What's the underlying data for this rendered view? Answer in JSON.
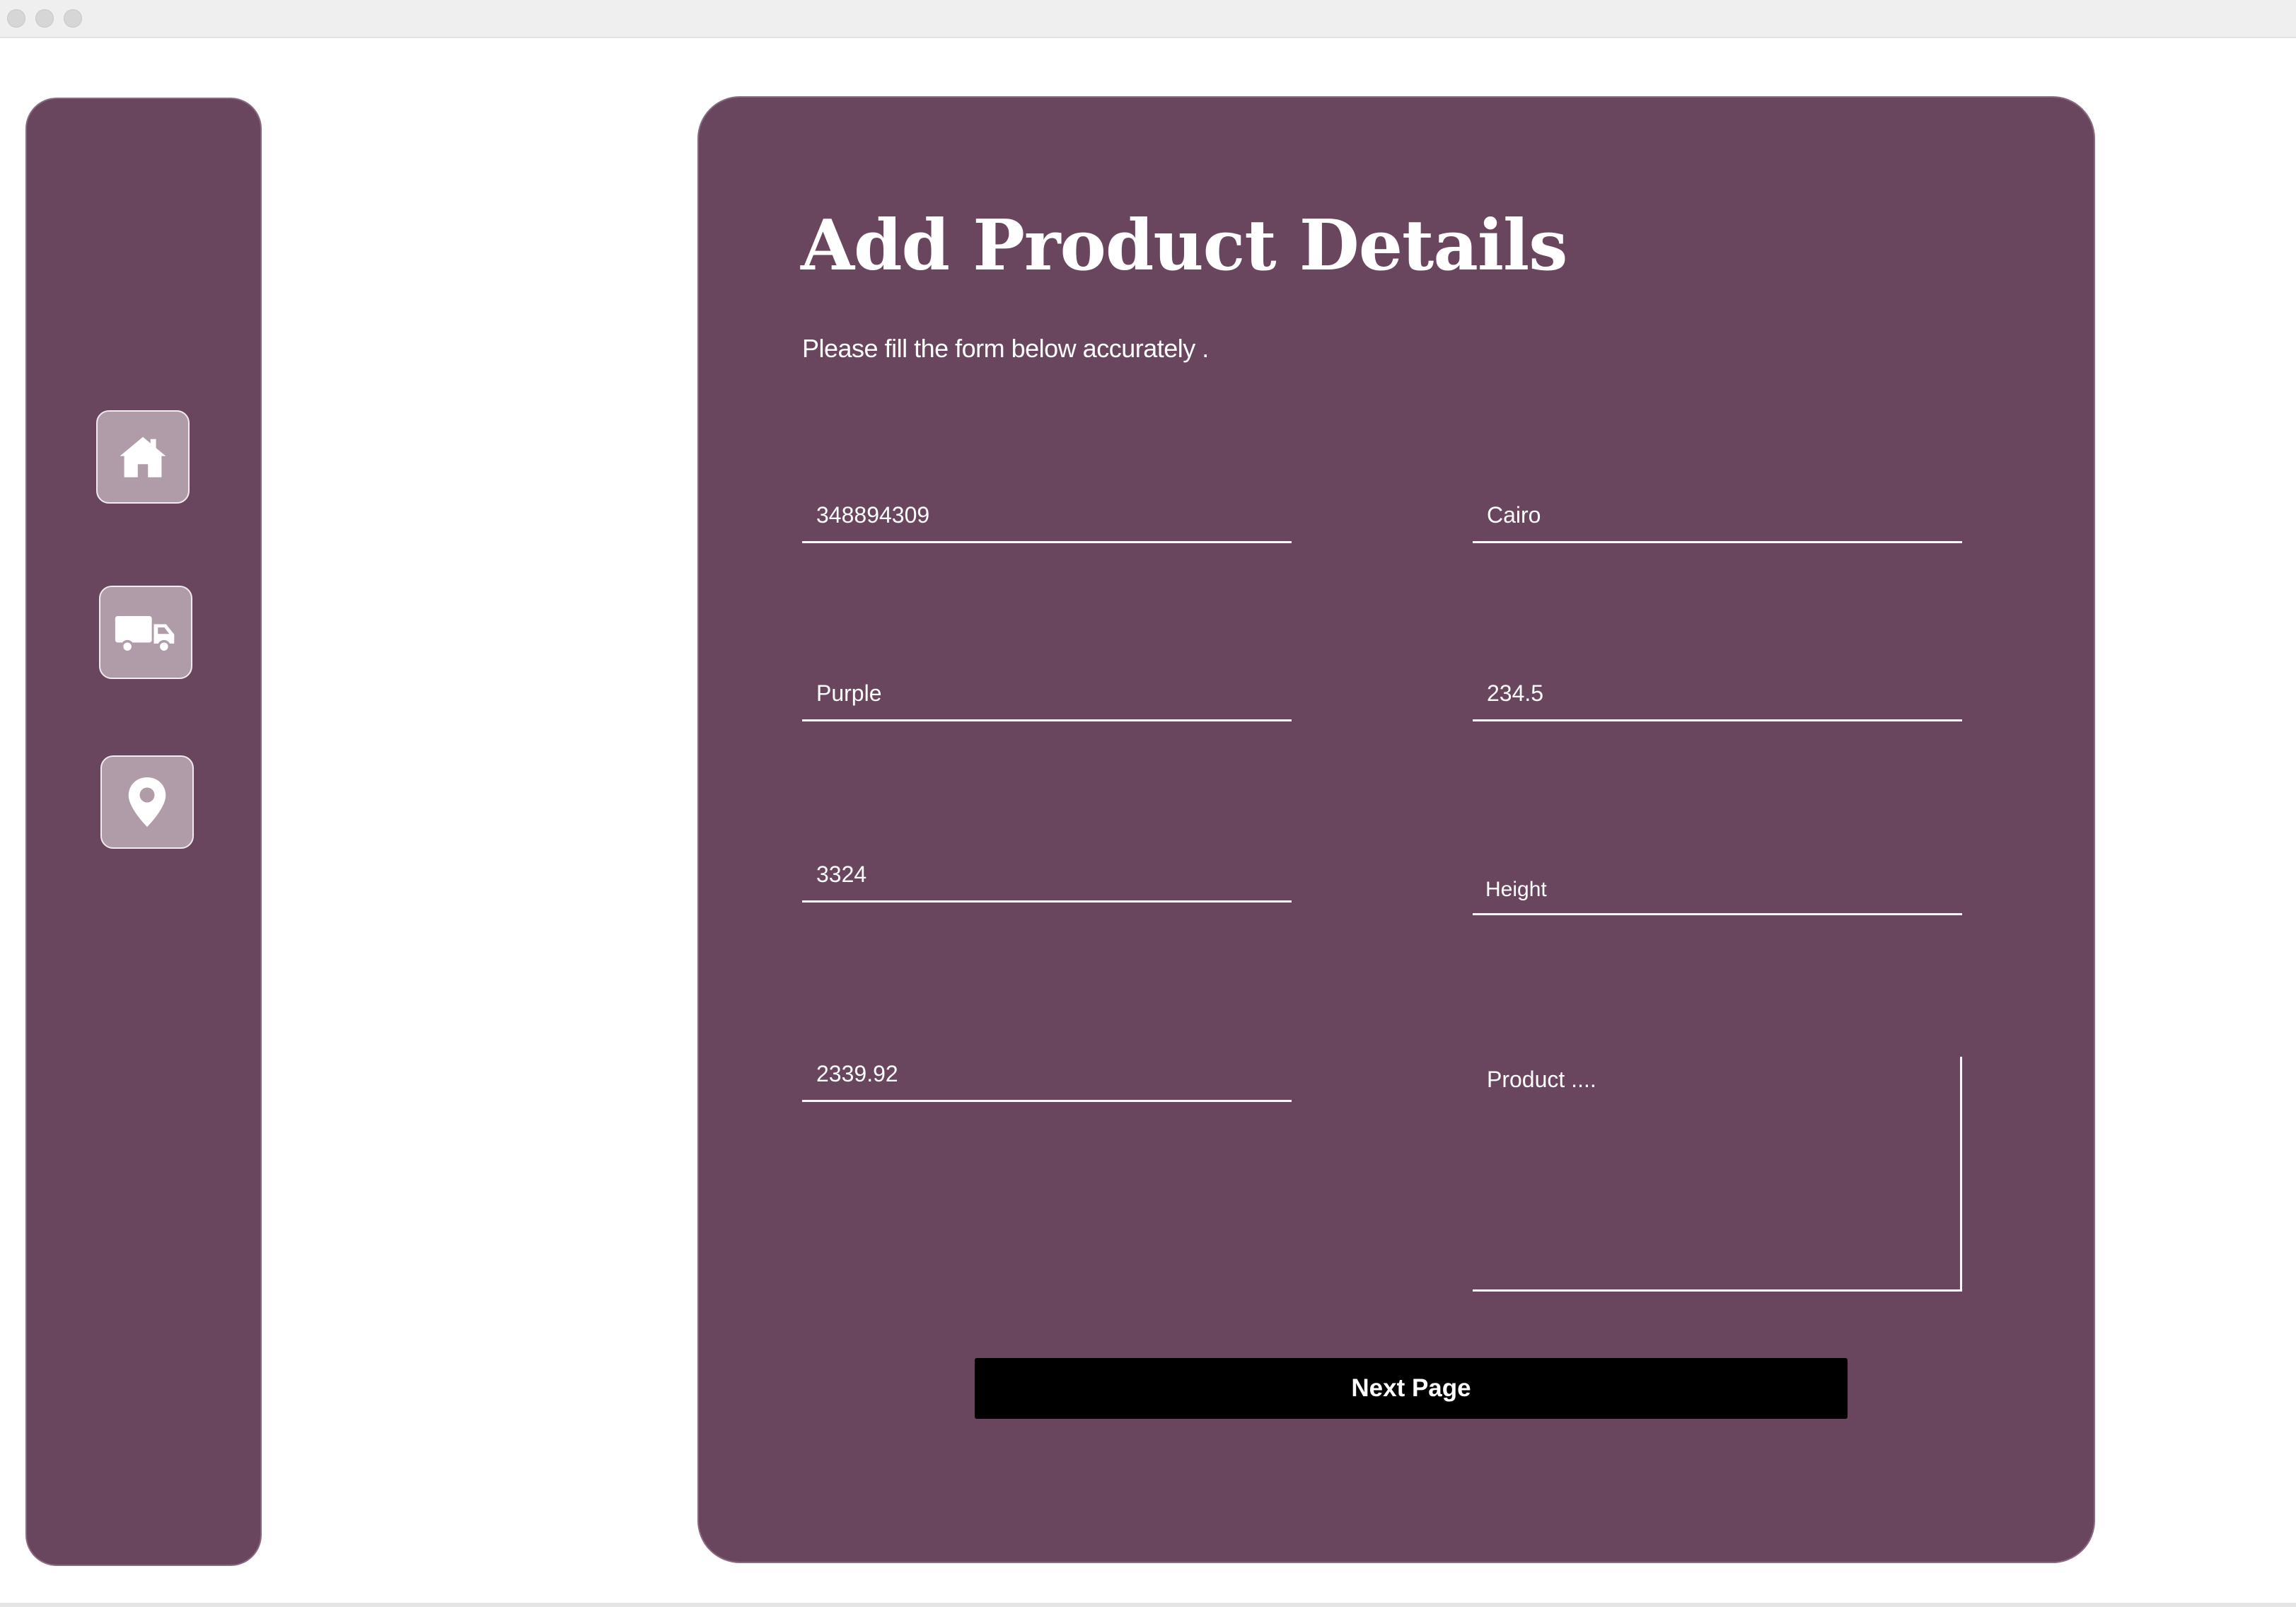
{
  "window": {
    "controls": [
      "close",
      "minimize",
      "zoom"
    ]
  },
  "sidebar": {
    "items": [
      {
        "name": "home",
        "icon": "home-icon"
      },
      {
        "name": "delivery",
        "icon": "truck-icon"
      },
      {
        "name": "location",
        "icon": "map-pin-icon"
      }
    ]
  },
  "form": {
    "title": "Add Product Details",
    "subtitle": "Please fill the form below accurately .",
    "fields": {
      "product_id": {
        "value": "348894309"
      },
      "city": {
        "value": "Cairo"
      },
      "color": {
        "value": "Purple"
      },
      "weight": {
        "value": "234.5"
      },
      "quantity": {
        "value": "3324"
      },
      "height": {
        "value": "",
        "placeholder": "Height"
      },
      "price": {
        "value": "2339.92"
      },
      "description": {
        "value": "",
        "placeholder": "Product ...."
      }
    },
    "next_label": "Next Page"
  },
  "colors": {
    "panel": "#69465e",
    "nav_button": "#b09ca9",
    "text": "#ffffff",
    "button": "#000000",
    "titlebar": "#efefef"
  }
}
